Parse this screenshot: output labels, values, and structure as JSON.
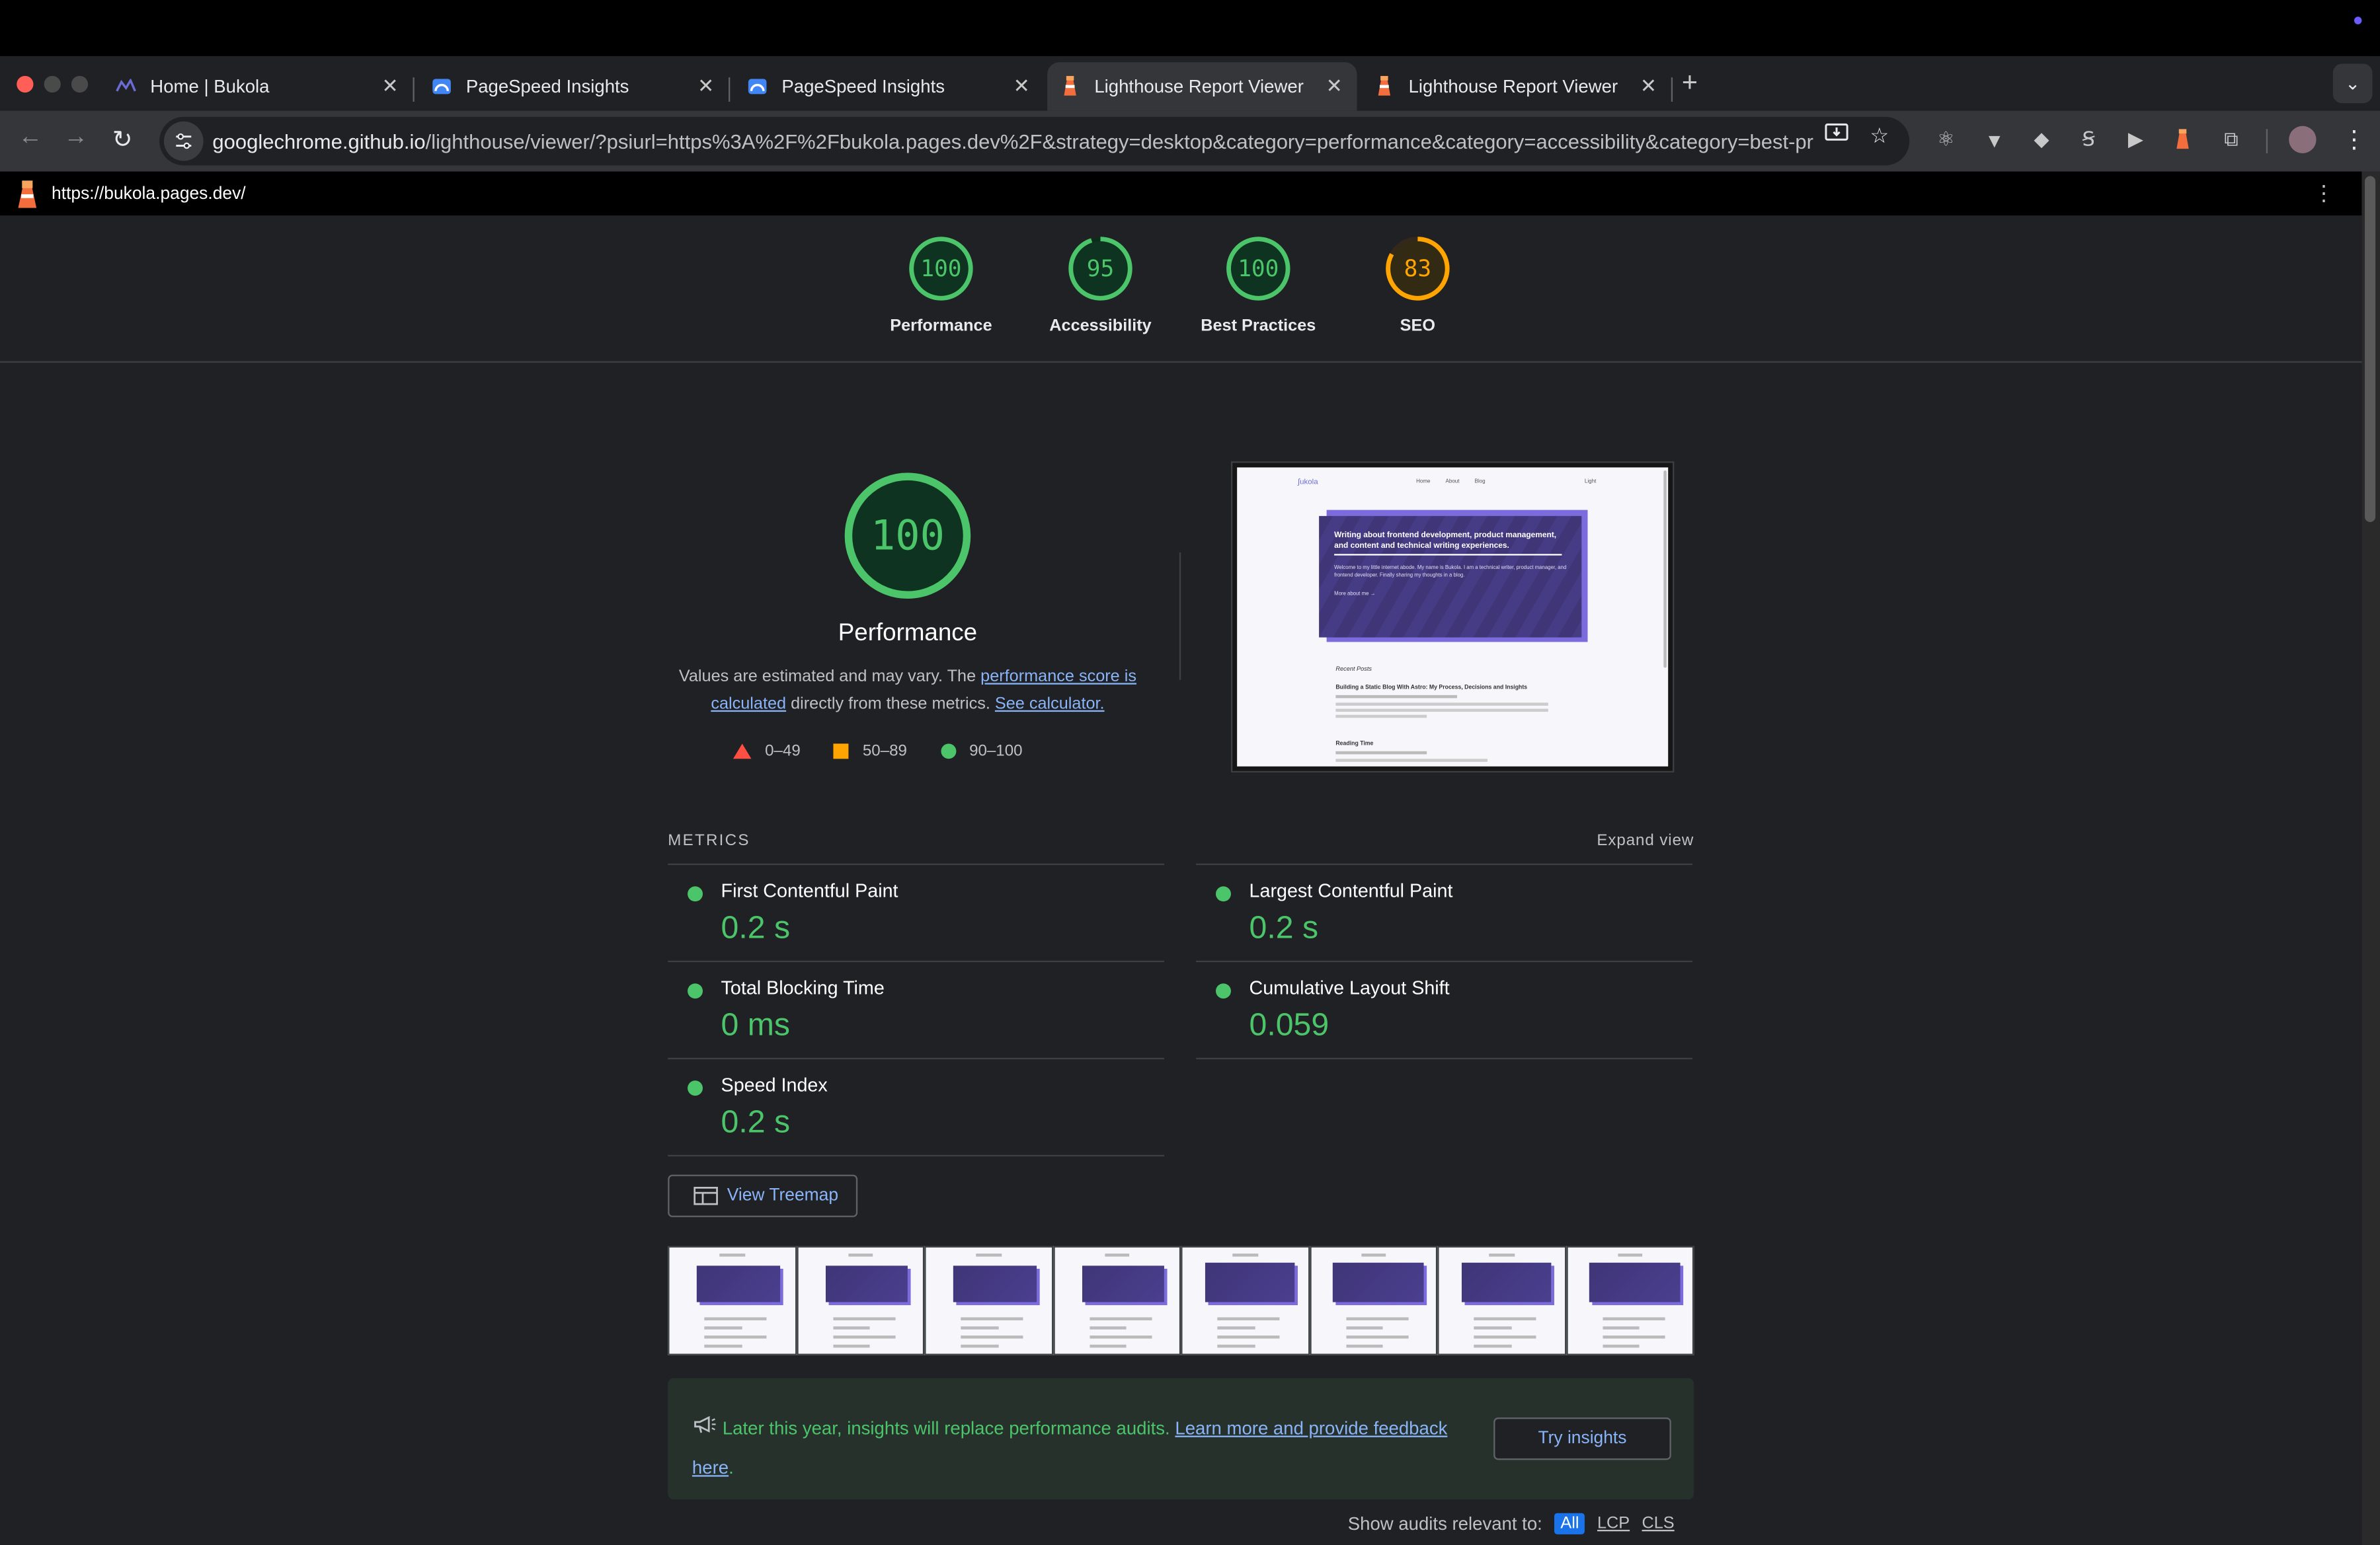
{
  "browser": {
    "tabs": [
      {
        "title": "Home | Bukola",
        "active": false,
        "icon": "bukola-favicon"
      },
      {
        "title": "PageSpeed Insights",
        "active": false,
        "icon": "pagespeed-icon"
      },
      {
        "title": "PageSpeed Insights",
        "active": false,
        "icon": "pagespeed-icon"
      },
      {
        "title": "Lighthouse Report Viewer",
        "active": true,
        "icon": "lighthouse-icon"
      },
      {
        "title": "Lighthouse Report Viewer",
        "active": false,
        "icon": "lighthouse-icon"
      }
    ],
    "address_host": "googlechrome.github.io",
    "address_rest": "/lighthouse/viewer/?psiurl=https%3A%2F%2Fbukola.pages.dev%2F&strategy=desktop&category=performance&category=accessibility&category=best-practi..."
  },
  "report": {
    "url": "https://bukola.pages.dev/",
    "gauges": [
      {
        "score": "100",
        "label": "Performance",
        "value": 100,
        "color": "#4bc46a"
      },
      {
        "score": "95",
        "label": "Accessibility",
        "value": 95,
        "color": "#4bc46a"
      },
      {
        "score": "100",
        "label": "Best Practices",
        "value": 100,
        "color": "#4bc46a"
      },
      {
        "score": "83",
        "label": "SEO",
        "value": 83,
        "color": "#ffa400"
      }
    ],
    "performance": {
      "score": "100",
      "title": "Performance",
      "desc_1": "Values are estimated and may vary. The ",
      "desc_link_1": "performance score is calculated",
      "desc_2": " directly from these metrics. ",
      "desc_link_2": "See calculator."
    },
    "legend": [
      {
        "label": "0–49",
        "shape": "triangle",
        "color": "#ff4e42"
      },
      {
        "label": "50–89",
        "shape": "square",
        "color": "#ffa400"
      },
      {
        "label": "90–100",
        "shape": "circle",
        "color": "#4bc46a"
      }
    ],
    "metrics_header": "METRICS",
    "expand_view": "Expand view",
    "metrics": [
      {
        "title": "First Contentful Paint",
        "value": "0.2 s"
      },
      {
        "title": "Largest Contentful Paint",
        "value": "0.2 s"
      },
      {
        "title": "Total Blocking Time",
        "value": "0 ms"
      },
      {
        "title": "Cumulative Layout Shift",
        "value": "0.059"
      },
      {
        "title": "Speed Index",
        "value": "0.2 s"
      }
    ],
    "treemap_button": "View Treemap",
    "final_screenshot": {
      "nav": [
        "Home",
        "About",
        "Blog"
      ],
      "theme": "Light",
      "hero_title": "Writing about frontend development, product management, and content and technical writing experiences.",
      "hero_text": "Welcome to my little internet abode. My name is Bukola. I am a technical writer, product manager, and frontend developer. Finally sharing my thoughts in a blog.",
      "hero_link": "More about me →",
      "recent": "Recent Posts",
      "post1": "Building a Static Blog With Astro: My Process, Decisions and Insights",
      "post2": "Reading Time"
    },
    "filmstrip_frames": 8,
    "notice": {
      "text": "Later this year, insights will replace performance audits. ",
      "link": "Learn more and provide feedback here",
      "after": ".",
      "button": "Try insights"
    },
    "relevant": {
      "label": "Show audits relevant to:",
      "chips": [
        "All",
        "LCP",
        "CLS"
      ]
    }
  }
}
